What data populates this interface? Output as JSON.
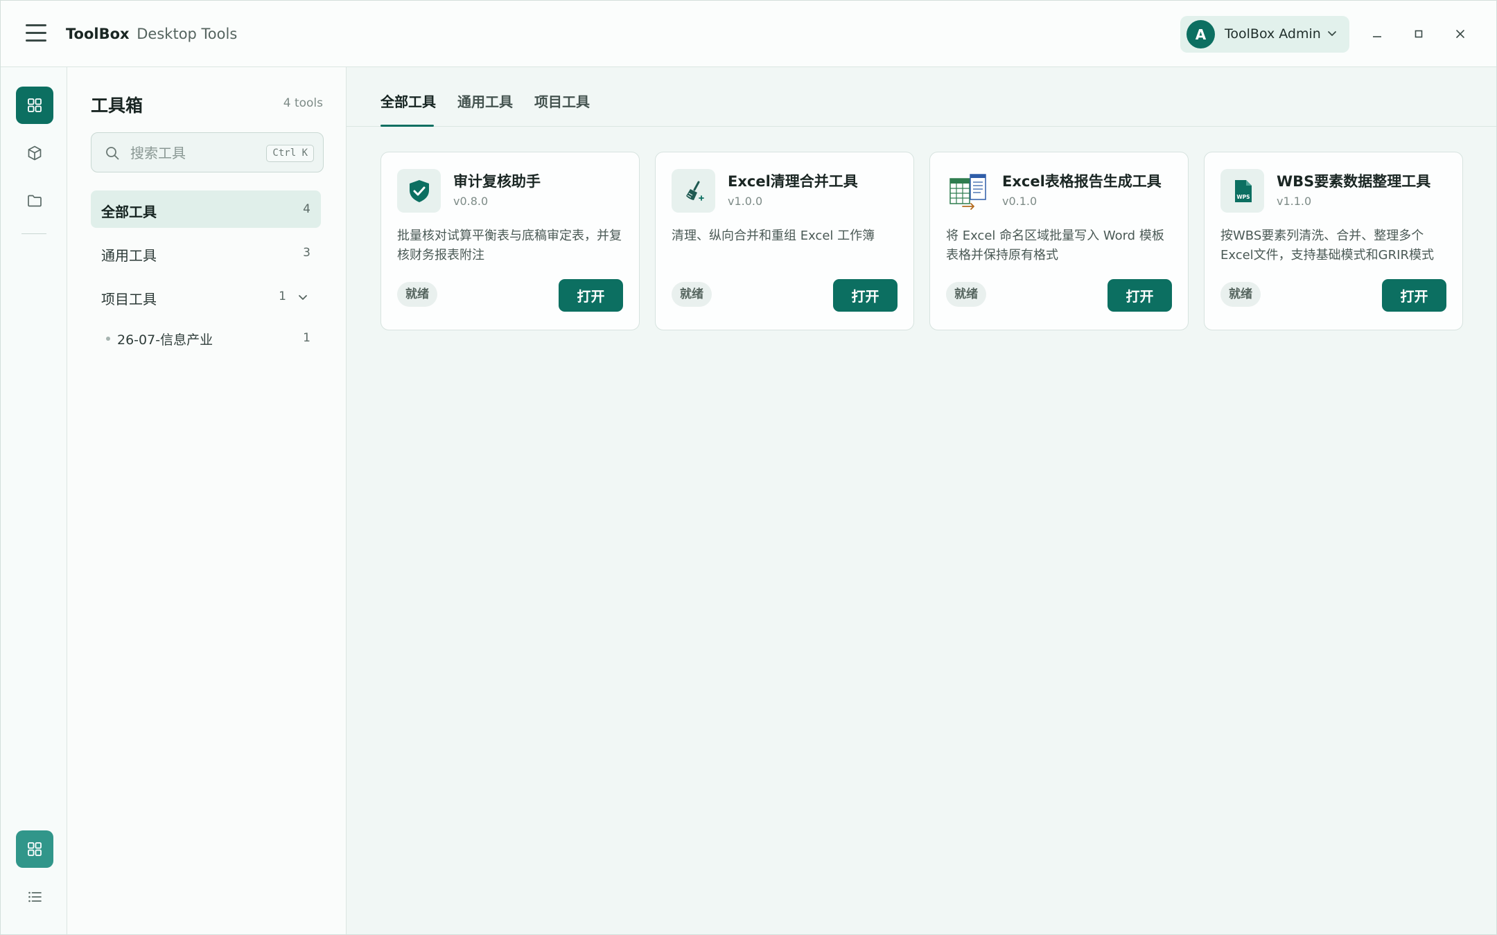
{
  "titlebar": {
    "brand_bold": "ToolBox",
    "brand_sub": "Desktop Tools",
    "user_initial": "A",
    "user_name": "ToolBox Admin"
  },
  "sidebar": {
    "title": "工具箱",
    "count_label": "4 tools",
    "search_placeholder": "搜索工具",
    "search_shortcut": "Ctrl K",
    "items": [
      {
        "label": "全部工具",
        "count": "4"
      },
      {
        "label": "通用工具",
        "count": "3"
      },
      {
        "label": "项目工具",
        "count": "1"
      }
    ],
    "sub_items": [
      {
        "label": "26-07-信息产业",
        "count": "1"
      }
    ]
  },
  "tabs": [
    {
      "label": "全部工具"
    },
    {
      "label": "通用工具"
    },
    {
      "label": "项目工具"
    }
  ],
  "cards": [
    {
      "name": "审计复核助手",
      "version": "v0.8.0",
      "desc": "批量核对试算平衡表与底稿审定表，并复核财务报表附注",
      "status": "就绪",
      "action": "打开",
      "icon": "shield-check-icon"
    },
    {
      "name": "Excel清理合并工具",
      "version": "v1.0.0",
      "desc": "清理、纵向合并和重组 Excel 工作簿",
      "status": "就绪",
      "action": "打开",
      "icon": "broom-icon"
    },
    {
      "name": "Excel表格报告生成工具",
      "version": "v0.1.0",
      "desc": "将 Excel 命名区域批量写入 Word 模板表格并保持原有格式",
      "status": "就绪",
      "action": "打开",
      "icon": "spreadsheet-to-doc-icon"
    },
    {
      "name": "WBS要素数据整理工具",
      "version": "v1.1.0",
      "desc": "按WBS要素列清洗、合并、整理多个Excel文件，支持基础模式和GRIR模式",
      "status": "就绪",
      "action": "打开",
      "icon": "wps-file-icon",
      "icon_text": "WPS"
    }
  ],
  "colors": {
    "accent": "#0c6f61",
    "accent_light": "#31968a",
    "selected_bg": "#e0efea",
    "page_bg": "#f1f7f5"
  }
}
